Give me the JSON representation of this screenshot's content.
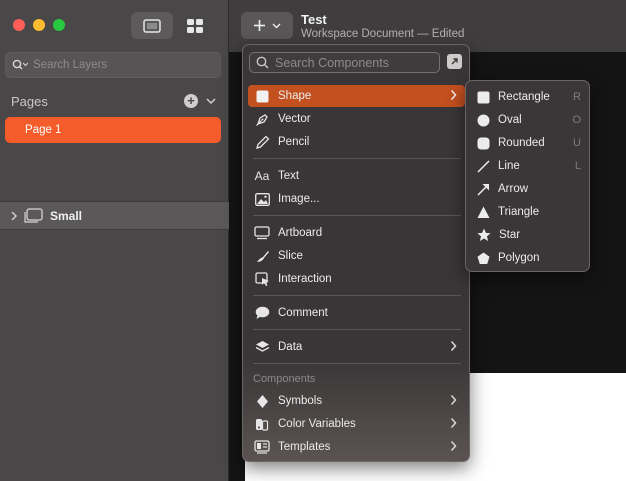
{
  "window": {
    "title": "Test",
    "subtitle": "Workspace Document — Edited"
  },
  "sidebar": {
    "search_placeholder": "Search Layers",
    "pages_header": "Pages",
    "pages": [
      {
        "label": "Page 1",
        "selected": true
      }
    ],
    "layers": [
      {
        "label": "Small",
        "icon": "artboard-icon"
      }
    ]
  },
  "insert_menu": {
    "search_placeholder": "Search Components",
    "items": [
      {
        "label": "Shape",
        "icon": "shape-icon",
        "submenu": true,
        "selected": true
      },
      {
        "label": "Vector",
        "icon": "pen-icon"
      },
      {
        "label": "Pencil",
        "icon": "pencil-icon"
      },
      {
        "label": "Text",
        "icon": "text-icon"
      },
      {
        "label": "Image...",
        "icon": "image-icon"
      },
      {
        "label": "Artboard",
        "icon": "artboard-icon"
      },
      {
        "label": "Slice",
        "icon": "slice-icon"
      },
      {
        "label": "Interaction",
        "icon": "interaction-icon"
      },
      {
        "label": "Comment",
        "icon": "comment-icon"
      },
      {
        "label": "Data",
        "icon": "layers-icon",
        "submenu": true
      }
    ],
    "group_label": "Components",
    "components": [
      {
        "label": "Symbols",
        "icon": "symbol-icon",
        "submenu": true
      },
      {
        "label": "Color Variables",
        "icon": "color-variables-icon",
        "submenu": true
      },
      {
        "label": "Templates",
        "icon": "templates-icon",
        "submenu": true
      }
    ]
  },
  "shape_submenu": [
    {
      "label": "Rectangle",
      "shortcut": "R",
      "icon": "rectangle-icon"
    },
    {
      "label": "Oval",
      "shortcut": "O",
      "icon": "oval-icon"
    },
    {
      "label": "Rounded",
      "shortcut": "U",
      "icon": "rounded-rect-icon"
    },
    {
      "label": "Line",
      "shortcut": "L",
      "icon": "line-icon"
    },
    {
      "label": "Arrow",
      "shortcut": "",
      "icon": "arrow-icon"
    },
    {
      "label": "Triangle",
      "shortcut": "",
      "icon": "triangle-icon"
    },
    {
      "label": "Star",
      "shortcut": "",
      "icon": "star-icon"
    },
    {
      "label": "Polygon",
      "shortcut": "",
      "icon": "polygon-icon"
    }
  ],
  "colors": {
    "accent": "#f45c2c",
    "menu_selection": "#c3501f"
  }
}
